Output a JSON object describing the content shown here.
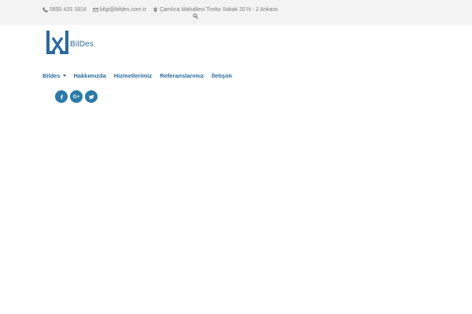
{
  "topbar": {
    "phone": "0850 433 1818",
    "email": "bilgi@bildes.com.tr",
    "address": "Çamlıca Mahallesi Timko Sokak 20 N - 2 Ankara"
  },
  "logo": {
    "text": "BilDes"
  },
  "nav": {
    "items": [
      {
        "label": "Bildes"
      },
      {
        "label": "Hakkımızda"
      },
      {
        "label": "Hizmetlerimiz"
      },
      {
        "label": "Referanslarımız"
      },
      {
        "label": "İletişim"
      }
    ]
  },
  "social": {
    "googleplus_label": "G+"
  },
  "colors": {
    "brand": "#2a6aa0",
    "social_bg": "#2a7aa8",
    "topbar_bg": "#f3f3f3"
  }
}
